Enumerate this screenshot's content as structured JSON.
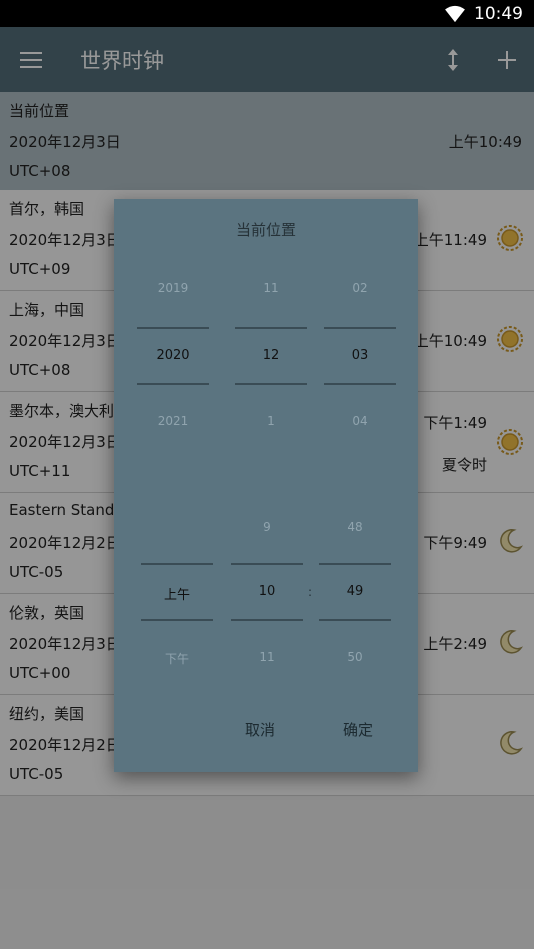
{
  "status": {
    "time": "10:49"
  },
  "appbar": {
    "title": "世界时钟",
    "menu_icon": "hamburger-icon",
    "sort_icon": "sort-vertical-icon",
    "add_icon": "add-icon"
  },
  "current": {
    "label": "当前位置",
    "date": "2020年12月3日",
    "tz": "UTC+08",
    "time": "上午10:49"
  },
  "cities": [
    {
      "name": "首尔，韩国",
      "date": "2020年12月3日",
      "tz": "UTC+09",
      "time": "上午11:49",
      "dst": "",
      "icon": "sun-icon"
    },
    {
      "name": "上海，中国",
      "date": "2020年12月3日",
      "tz": "UTC+08",
      "time": "上午10:49",
      "dst": "",
      "icon": "sun-icon"
    },
    {
      "name": "墨尔本，澳大利亚",
      "date": "2020年12月3日",
      "tz": "UTC+11",
      "time": "下午1:49",
      "dst": "夏令时",
      "icon": "sun-icon"
    },
    {
      "name": "Eastern Standa",
      "date": "2020年12月2日",
      "tz": "UTC-05",
      "time": "下午9:49",
      "dst": "",
      "icon": "moon-icon"
    },
    {
      "name": "伦敦，英国",
      "date": "2020年12月3日",
      "tz": "UTC+00",
      "time": "上午2:49",
      "dst": "",
      "icon": "moon-icon"
    },
    {
      "name": "纽约，美国",
      "date": "2020年12月2日",
      "tz": "UTC-05",
      "time": "",
      "dst": "",
      "icon": "moon-icon"
    }
  ],
  "dialog": {
    "title": "当前位置",
    "year": {
      "prev": "2019",
      "sel": "2020",
      "next": "2021"
    },
    "month": {
      "prev": "11",
      "sel": "12",
      "next": "1"
    },
    "day": {
      "prev": "02",
      "sel": "03",
      "next": "04"
    },
    "ampm": {
      "prev": "",
      "sel": "上午",
      "next": "下午"
    },
    "hour": {
      "prev": "9",
      "sel": "10",
      "next": "11"
    },
    "minute": {
      "prev": "48",
      "sel": "49",
      "next": "50"
    },
    "colon": ":",
    "cancel": "取消",
    "confirm": "确定"
  }
}
